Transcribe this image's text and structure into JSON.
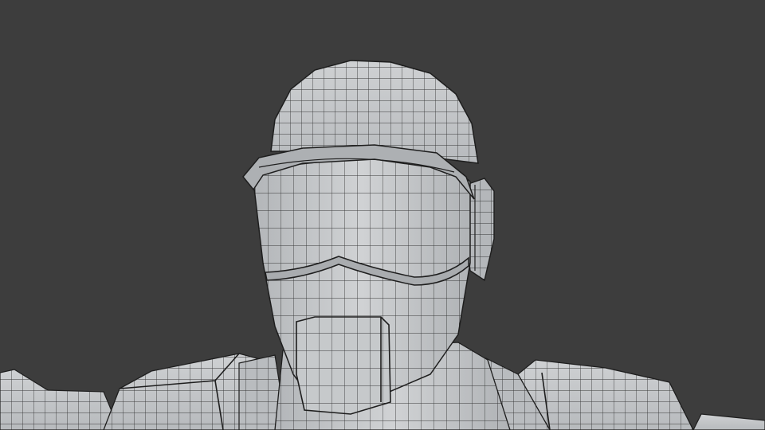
{
  "viewport": {
    "background_color": "#3d3d3d",
    "surface_color": "#c9cbcd",
    "surface_shadow_color": "#9ea1a4",
    "wire_color": "#1e1e1e",
    "display_mode": "wireframe-over-solid"
  },
  "model": {
    "parts": [
      "helmet-dome",
      "helmet-brim",
      "face-mask",
      "visor-ridge",
      "chin-plate",
      "ear-piece",
      "neck",
      "left-shoulder-pad",
      "right-shoulder-pad",
      "chest-plate",
      "left-arm"
    ]
  }
}
